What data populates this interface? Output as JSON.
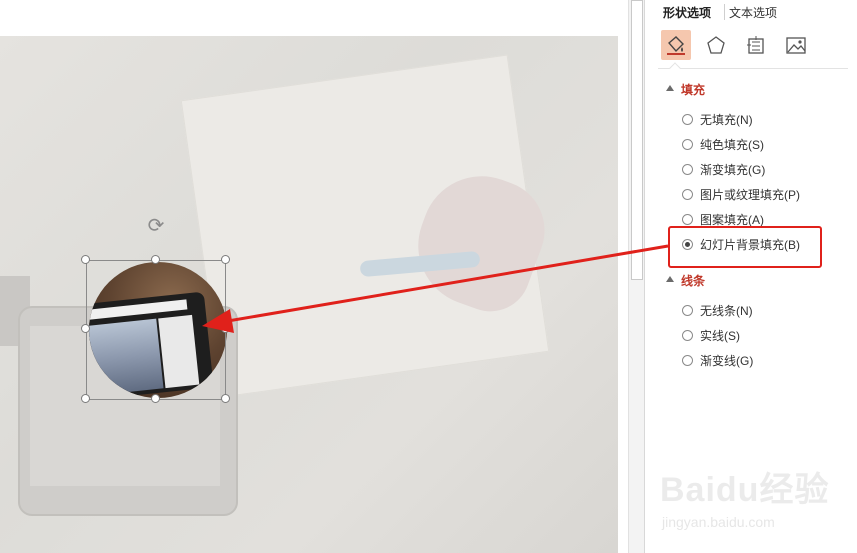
{
  "pane": {
    "tabs": [
      {
        "label": "形状选项",
        "active": true
      },
      {
        "label": "文本选项",
        "active": false
      }
    ],
    "category_icons": [
      "fill-line-icon",
      "effects-pentagon-icon",
      "size-properties-icon",
      "picture-icon"
    ],
    "fill_section": {
      "title": "填充",
      "options": [
        {
          "label": "无填充(N)",
          "checked": false
        },
        {
          "label": "纯色填充(S)",
          "checked": false
        },
        {
          "label": "渐变填充(G)",
          "checked": false
        },
        {
          "label": "图片或纹理填充(P)",
          "checked": false
        },
        {
          "label": "图案填充(A)",
          "checked": false
        },
        {
          "label": "幻灯片背景填充(B)",
          "checked": true
        }
      ]
    },
    "line_section": {
      "title": "线条",
      "options": [
        {
          "label": "无线条(N)",
          "checked": false
        },
        {
          "label": "实线(S)",
          "checked": false
        },
        {
          "label": "渐变线(G)",
          "checked": false
        }
      ]
    }
  },
  "watermark": {
    "brand": "Baidu经验",
    "url": "jingyan.baidu.com"
  },
  "colors": {
    "accent": "#c0392b",
    "annotation": "#e0211b",
    "active_icon_bg": "#f5c7ae"
  }
}
